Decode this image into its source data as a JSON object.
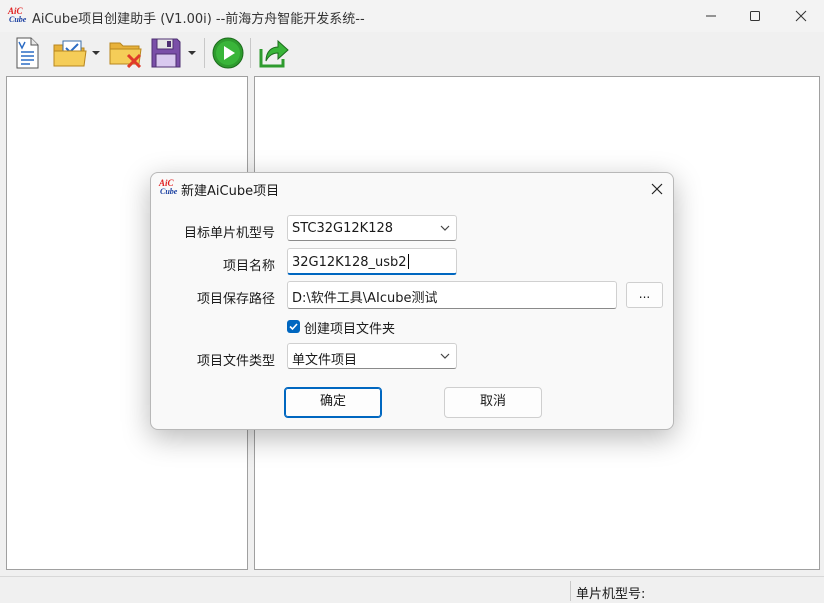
{
  "window": {
    "title": "AiCube项目创建助手 (V1.00i) --前海方舟智能开发系统--",
    "logo_top": "AiC",
    "logo_bottom": "Cube"
  },
  "toolbar": {
    "icons": [
      "new-file-icon",
      "open-project-icon",
      "close-project-icon",
      "save-icon",
      "run-icon",
      "export-icon"
    ]
  },
  "statusbar": {
    "chip_model_label": "单片机型号:"
  },
  "dialog": {
    "title": "新建AiCube项目",
    "target_mcu_label": "目标单片机型号",
    "target_mcu_value": "STC32G12K128",
    "project_name_label": "项目名称",
    "project_name_value": "32G12K128_usb2",
    "save_path_label": "项目保存路径",
    "save_path_value": "D:\\软件工具\\AIcube测试",
    "browse_label": "...",
    "create_folder_label": "创建项目文件夹",
    "create_folder_checked": true,
    "file_type_label": "项目文件类型",
    "file_type_value": "单文件项目",
    "ok_label": "确定",
    "cancel_label": "取消"
  },
  "colors": {
    "accent": "#0067c0",
    "run_green": "#2e9b2e",
    "folder_yellow": "#f2c744",
    "save_purple": "#7a4fa8",
    "close_red": "#e03b2a"
  }
}
